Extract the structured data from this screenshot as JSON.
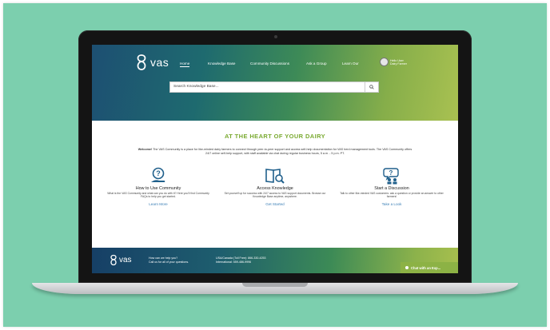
{
  "brand": {
    "logo_text": "vas",
    "footer_logo_text": "vas"
  },
  "nav": {
    "items": [
      {
        "label": "Home",
        "active": true
      },
      {
        "label": "Knowledge Base",
        "active": false
      },
      {
        "label": "Community Discussions",
        "active": false
      },
      {
        "label": "Ask a Group",
        "active": false
      },
      {
        "label": "Learn Our",
        "active": false
      }
    ]
  },
  "user": {
    "line1": "Hello User",
    "line2": "Dairy Farmer"
  },
  "search": {
    "placeholder": "Search Knowledge Base..."
  },
  "headline": "AT THE HEART OF YOUR DAIRY",
  "welcome": {
    "lead": "Welcome!",
    "text": " The VAS Community is a place for like-minded dairy farmers to connect through peer-to-peer support and access self-help documentation for VAS herd management tools. The VAS Community offers 24/7 online self-help support, with staff available via chat during regular business hours, 5 a.m. - 5 p.m. PT."
  },
  "features": [
    {
      "icon": "question-hand-icon",
      "title": "How to Use Community",
      "desc": "What is the VAS Community and what can you do with it? Here you'll find Community FAQs to help you get started.",
      "link": "Learn More"
    },
    {
      "icon": "book-search-icon",
      "title": "Access Knowledge",
      "desc": "Set yourself up for success with 24/7 access to VAS support documents. Browse our Knowledge Base anytime, anywhere.",
      "link": "Get Started"
    },
    {
      "icon": "people-question-icon",
      "title": "Start a Discussion",
      "desc": "Talk to other like-minded VAS customers: ask a question or provide an answer to other farmers!",
      "link": "Take a Look"
    }
  ],
  "footer": {
    "help_line1": "How can we help you?",
    "help_line2": "Call us for all of your questions.",
    "contact_line1": "USA/Canada (Toll Free): 866-330-4253",
    "contact_line2": "International: 559-486-9996"
  },
  "chat": {
    "label": "Chat with an Exp..."
  },
  "colors": {
    "background": "#7ccfae",
    "accent_green": "#7aaa31",
    "link_blue": "#3b7fb6",
    "hero_start": "#1d4f72",
    "hero_end": "#a9c151"
  }
}
